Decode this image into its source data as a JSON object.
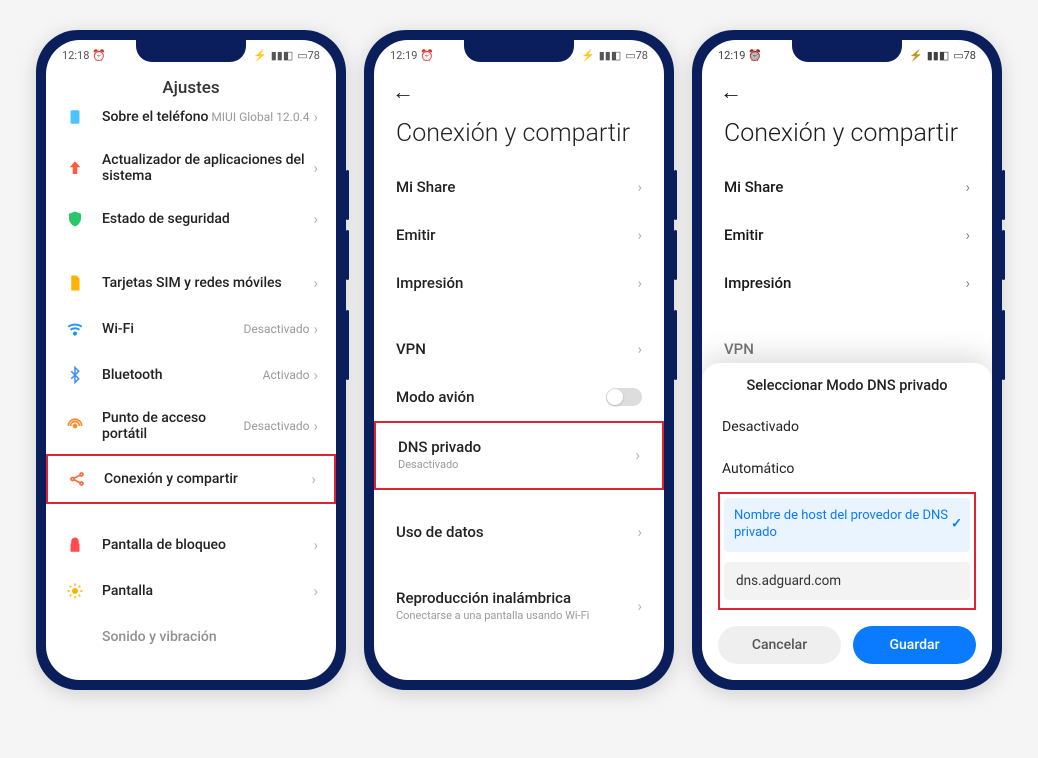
{
  "status_time": "12:18",
  "status_time2": "12:19",
  "status_time3": "12:19",
  "battery": "78",
  "phone1": {
    "title": "Ajustes",
    "items": [
      {
        "label": "Sobre el teléfono",
        "value": "MIUI Global 12.0.4"
      },
      {
        "label": "Actualizador de aplicaciones del sistema"
      },
      {
        "label": "Estado de seguridad"
      }
    ],
    "items2": [
      {
        "label": "Tarjetas SIM y redes móviles"
      },
      {
        "label": "Wi-Fi",
        "value": "Desactivado"
      },
      {
        "label": "Bluetooth",
        "value": "Activado"
      },
      {
        "label": "Punto de acceso portátil",
        "value": "Desactivado"
      },
      {
        "label": "Conexión y compartir"
      }
    ],
    "items3": [
      {
        "label": "Pantalla de bloqueo"
      },
      {
        "label": "Pantalla"
      },
      {
        "label": "Sonido y vibración"
      }
    ]
  },
  "phone2": {
    "title": "Conexión y compartir",
    "groupA": [
      {
        "label": "Mi Share"
      },
      {
        "label": "Emitir"
      },
      {
        "label": "Impresión"
      }
    ],
    "groupB": [
      {
        "label": "VPN"
      },
      {
        "label": "Modo avión"
      },
      {
        "label": "DNS privado",
        "sub": "Desactivado"
      }
    ],
    "groupC": [
      {
        "label": "Uso de datos"
      }
    ],
    "groupD": [
      {
        "label": "Reproducción inalámbrica",
        "sub": "Conectarse a una pantalla usando Wi-Fi"
      }
    ]
  },
  "phone3": {
    "title": "Conexión y compartir",
    "groupA": [
      {
        "label": "Mi Share"
      },
      {
        "label": "Emitir"
      },
      {
        "label": "Impresión"
      }
    ],
    "vpn_label": "VPN",
    "sheet": {
      "title": "Seleccionar Modo DNS privado",
      "opt1": "Desactivado",
      "opt2": "Automático",
      "selected": "Nombre de host del provedor de DNS privado",
      "input": "dns.adguard.com",
      "cancel": "Cancelar",
      "save": "Guardar"
    }
  }
}
